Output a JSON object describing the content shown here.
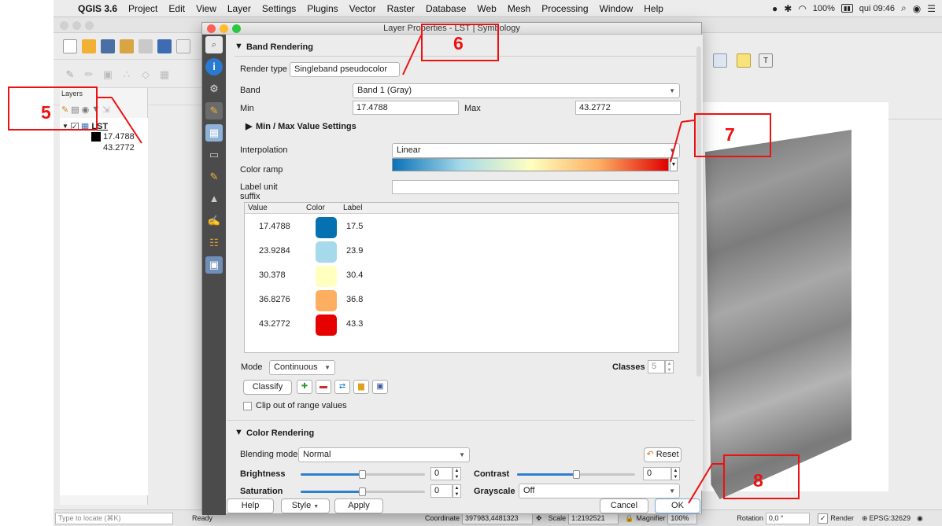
{
  "menubar": {
    "app": "QGIS 3.6",
    "items": [
      "Project",
      "Edit",
      "View",
      "Layer",
      "Settings",
      "Plugins",
      "Vector",
      "Raster",
      "Database",
      "Web",
      "Mesh",
      "Processing",
      "Window",
      "Help"
    ],
    "battery": "100%",
    "clock": "qui 09:46"
  },
  "dialog": {
    "title": "Layer Properties - LST | Symbology",
    "band_rendering": {
      "section": "Band Rendering",
      "render_type_label": "Render type",
      "render_type_value": "Singleband pseudocolor",
      "band_label": "Band",
      "band_value": "Band 1 (Gray)",
      "min_label": "Min",
      "min_value": "17.4788",
      "max_label": "Max",
      "max_value": "43.2772",
      "minmax_settings": "Min / Max Value Settings",
      "interpolation_label": "Interpolation",
      "interpolation_value": "Linear",
      "color_ramp_label": "Color ramp",
      "label_unit_label_1": "Label unit",
      "label_unit_label_2": "suffix",
      "label_unit_value": "",
      "table_headers": {
        "value": "Value",
        "color": "Color",
        "label": "Label"
      },
      "classes": [
        {
          "value": "17.4788",
          "color": "#0571b0",
          "label": "17.5"
        },
        {
          "value": "23.9284",
          "color": "#a6daea",
          "label": "23.9"
        },
        {
          "value": "30.378",
          "color": "#ffffc0",
          "label": "30.4"
        },
        {
          "value": "36.8276",
          "color": "#fdae61",
          "label": "36.8"
        },
        {
          "value": "43.2772",
          "color": "#e60000",
          "label": "43.3"
        }
      ],
      "mode_label": "Mode",
      "mode_value": "Continuous",
      "classes_label": "Classes",
      "classes_value": "5",
      "classify_button": "Classify",
      "clip_label": "Clip out of range values"
    },
    "color_rendering": {
      "section": "Color Rendering",
      "blending_label": "Blending mode",
      "blending_value": "Normal",
      "reset_button": "Reset",
      "brightness_label": "Brightness",
      "brightness_value": "0",
      "contrast_label": "Contrast",
      "contrast_value": "0",
      "saturation_label": "Saturation",
      "saturation_value": "0",
      "grayscale_label": "Grayscale",
      "grayscale_value": "Off"
    },
    "footer": {
      "help": "Help",
      "style": "Style",
      "apply": "Apply",
      "cancel": "Cancel",
      "ok": "OK"
    }
  },
  "layers_panel": {
    "title": "Layers",
    "layer_name": "LST",
    "legend_min": "17.4788",
    "legend_max": "43.2772"
  },
  "statusbar": {
    "locate_placeholder": "Type to locate (⌘K)",
    "ready": "Ready",
    "coordinate_label": "Coordinate",
    "coordinate_value": "397983,4481323",
    "scale_label": "Scale",
    "scale_value": "1:2192521",
    "magnifier_label": "Magnifier",
    "magnifier_value": "100%",
    "rotation_label": "Rotation",
    "rotation_value": "0,0 °",
    "render_label": "Render",
    "crs": "EPSG:32629"
  },
  "annotations": {
    "n5": "5",
    "n6": "6",
    "n7": "7",
    "n8": "8",
    "color": "#e11111"
  }
}
